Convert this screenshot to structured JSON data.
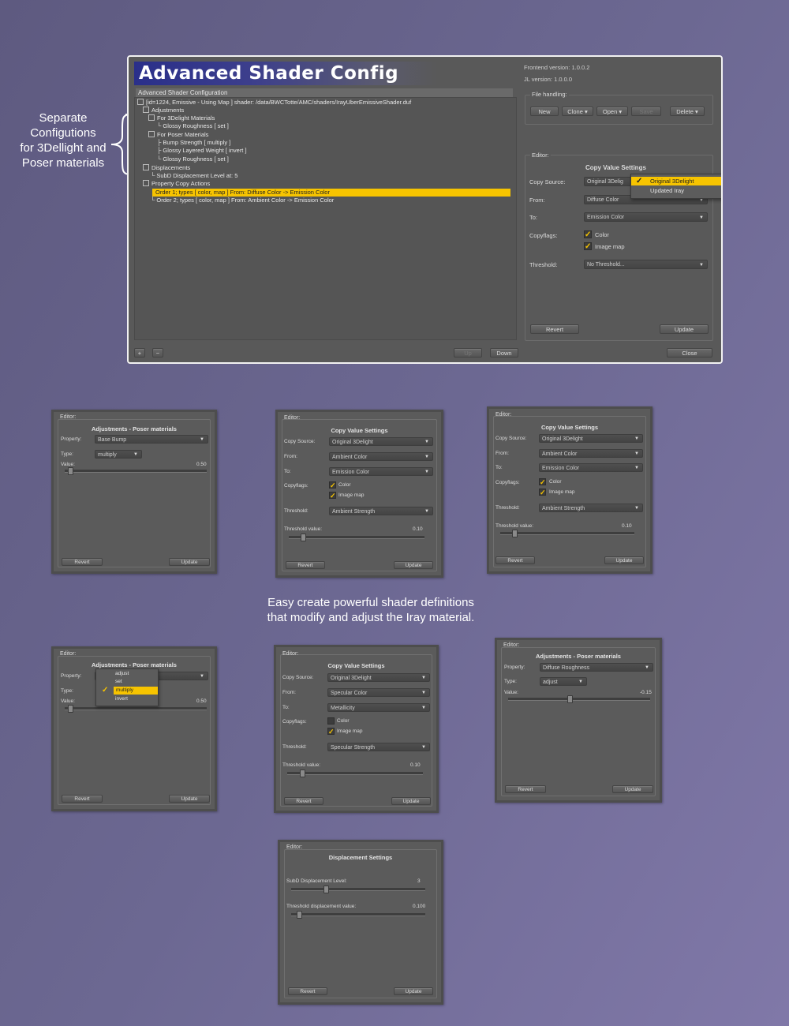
{
  "annotation_left": [
    "Separate",
    "Configutions",
    "for 3Dellight and",
    "Poser materials"
  ],
  "annotation_middle": [
    "Easy create powerful shader definitions",
    "that modify and adjust the Iray material."
  ],
  "main": {
    "title": "Advanced Shader Config",
    "frontend_version": "Frontend version: 1.0.0.2",
    "jl_version": "JL version: 1.0.0.0",
    "subtitle": "Advanced Shader Configuration",
    "tree": [
      "[id=1224, Emissive - Using Map ] shader: /data/BWCTotte/AMC/shaders/IrayUberEmissiveShader.duf",
      "Adjustments",
      "For 3Delight Materials",
      "Glossy Roughness [ set ]",
      "For Poser Materials",
      "Bump Strength [ multiply ]",
      "Glossy Layered Weight [ invert ]",
      "Glossy Roughness [ set ]",
      "Displacements",
      "SubD Displacement Level at: 5",
      "Property Copy Actions",
      "Order 1; types [ color, map ] From: Diffuse Color -> Emission Color",
      "Order 2; types [ color, map ] From: Ambient Color -> Emission Color"
    ],
    "file_handling": {
      "label": "File handling:",
      "buttons": [
        "New",
        "Clone",
        "Open",
        "Save",
        "Delete"
      ]
    },
    "editor": {
      "label": "Editor:",
      "heading": "Copy Value Settings",
      "copy_source_label": "Copy Source:",
      "copy_source_value": "Original 3Delig",
      "from_label": "From:",
      "from_value": "Diffuse Color",
      "to_label": "To:",
      "to_value": "Emission Color",
      "copyflags_label": "Copyflags:",
      "flag_color": "Color",
      "flag_image": "Image map",
      "threshold_label": "Threshold:",
      "threshold_value": "No Threshold...",
      "revert": "Revert",
      "update": "Update",
      "popup": [
        "Original 3Delight",
        "Updated Iray"
      ]
    },
    "bottom_buttons": {
      "up": "Up",
      "down": "Down",
      "close": "Close",
      "plus": "+",
      "minus": "−"
    }
  },
  "panels": {
    "p1": {
      "editor": "Editor:",
      "heading": "Adjustments - Poser materials",
      "property_label": "Property:",
      "property_value": "Base Bump",
      "type_label": "Type:",
      "type_value": "multiply",
      "value_label": "Value:",
      "value": "0.50",
      "revert": "Revert",
      "update": "Update"
    },
    "p2": {
      "editor": "Editor:",
      "heading": "Copy Value Settings",
      "cs_label": "Copy Source:",
      "cs_value": "Original 3Delight",
      "from_label": "From:",
      "from_value": "Ambient Color",
      "to_label": "To:",
      "to_value": "Emission Color",
      "cf_label": "Copyflags:",
      "flag_color": "Color",
      "flag_image": "Image map",
      "th_label": "Threshold:",
      "th_value": "Ambient Strength",
      "tv_label": "Threshold value:",
      "tv_value": "0.10",
      "revert": "Revert",
      "update": "Update"
    },
    "p3": {
      "editor": "Editor:",
      "heading": "Copy Value Settings",
      "cs_label": "Copy Source:",
      "cs_value": "Original 3Delight",
      "from_label": "From:",
      "from_value": "Ambient Color",
      "to_label": "To:",
      "to_value": "Emission Color",
      "cf_label": "Copyflags:",
      "flag_color": "Color",
      "flag_image": "Image map",
      "th_label": "Threshold:",
      "th_value": "Ambient Strength",
      "tv_label": "Threshold value:",
      "tv_value": "0.10",
      "revert": "Revert",
      "update": "Update"
    },
    "p4": {
      "editor": "Editor:",
      "heading": "Adjustments - Poser materials",
      "property_label": "Property:",
      "type_label": "Type:",
      "value_label": "Value:",
      "value": "0.50",
      "popup": [
        "adjust",
        "set",
        "multiply",
        "invert"
      ],
      "revert": "Revert",
      "update": "Update"
    },
    "p5": {
      "editor": "Editor:",
      "heading": "Copy Value Settings",
      "cs_label": "Copy Source:",
      "cs_value": "Original 3Delight",
      "from_label": "From:",
      "from_value": "Specular Color",
      "to_label": "To:",
      "to_value": "Metallicity",
      "cf_label": "Copyflags:",
      "flag_color": "Color",
      "flag_image": "Image map",
      "th_label": "Threshold:",
      "th_value": "Specular Strength",
      "tv_label": "Threshold value:",
      "tv_value": "0.10",
      "revert": "Revert",
      "update": "Update"
    },
    "p6": {
      "editor": "Editor:",
      "heading": "Adjustments - Poser materials",
      "property_label": "Property:",
      "property_value": "Diffuse Roughness",
      "type_label": "Type:",
      "type_value": "adjust",
      "value_label": "Value:",
      "value": "-0.15",
      "revert": "Revert",
      "update": "Update"
    },
    "p7": {
      "editor": "Editor:",
      "heading": "Displacement Settings",
      "subd_label": "SubD Displacement Level:",
      "subd_value": "3",
      "thd_label": "Threshold displacement value:",
      "thd_value": "0.100",
      "revert": "Revert",
      "update": "Update"
    }
  }
}
